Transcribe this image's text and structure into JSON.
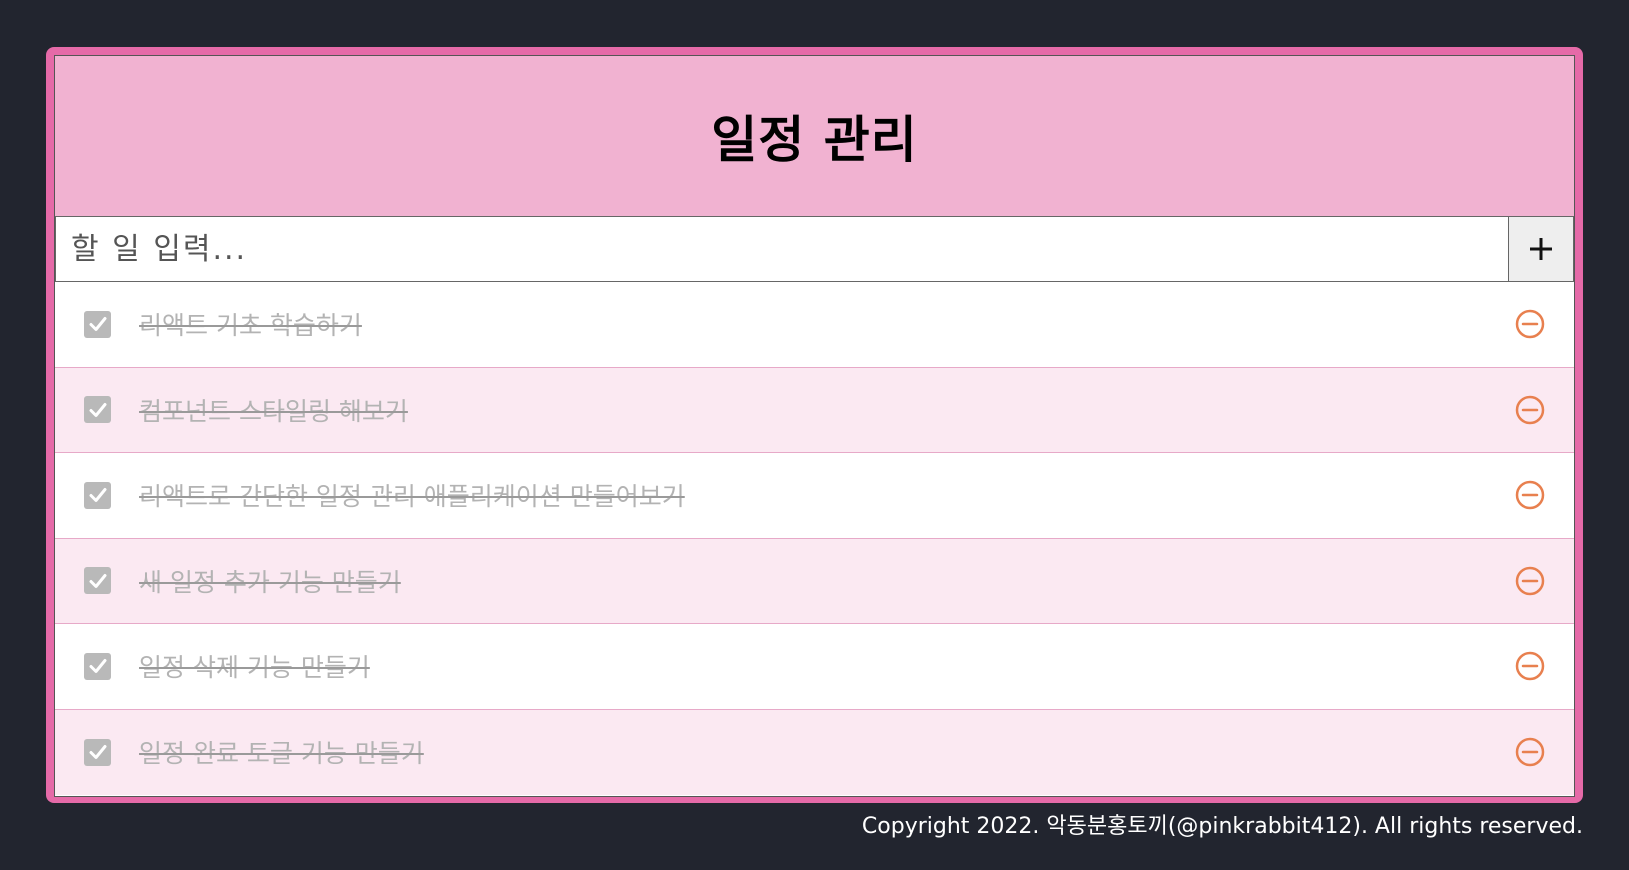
{
  "header": {
    "title": "일정 관리"
  },
  "input": {
    "placeholder": "할 일 입력...",
    "value": ""
  },
  "add_button": {
    "label": "+"
  },
  "todos": [
    {
      "text": "리액트 기초 학습하기",
      "checked": true
    },
    {
      "text": "컴포넌트 스타일링 해보기",
      "checked": true
    },
    {
      "text": "리액트로 간단한 일정 관리 애플리케이션 만들어보기",
      "checked": true
    },
    {
      "text": "새 일정 추가 기능 만들기",
      "checked": true
    },
    {
      "text": "일정 삭제 기능 만들기",
      "checked": true
    },
    {
      "text": "일정 완료 토글 기능 만들기",
      "checked": true
    }
  ],
  "footer": {
    "copyright": "Copyright 2022. 악동분홍토끼(@pinkrabbit412). All rights reserved."
  },
  "colors": {
    "background": "#22252f",
    "frame": "#e56aa8",
    "header": "#f1b2d1",
    "row_alt": "#fbe9f2",
    "remove_icon": "#e8804f",
    "checkbox": "#b9b9b9"
  }
}
